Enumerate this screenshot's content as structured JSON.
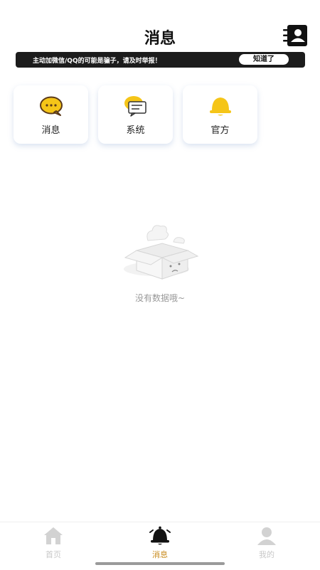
{
  "header": {
    "title": "消息"
  },
  "notice": {
    "text": "主动加微信/QQ的可能是骗子，请及时举报！",
    "button_label": "知道了"
  },
  "categories": [
    {
      "label": "消息",
      "icon": "chat-bubble-icon"
    },
    {
      "label": "系统",
      "icon": "system-message-icon"
    },
    {
      "label": "官方",
      "icon": "bell-icon"
    }
  ],
  "empty_state": {
    "text": "没有数据哦~"
  },
  "tabbar": {
    "items": [
      {
        "label": "首页",
        "icon": "home-icon",
        "active": false
      },
      {
        "label": "消息",
        "icon": "bell-icon",
        "active": true
      },
      {
        "label": "我的",
        "icon": "user-icon",
        "active": false
      }
    ]
  },
  "colors": {
    "accent": "#f5c518",
    "active_tab": "#c88a1a",
    "notice_bg": "#1c1c1c",
    "inactive": "#c8c8c8"
  }
}
